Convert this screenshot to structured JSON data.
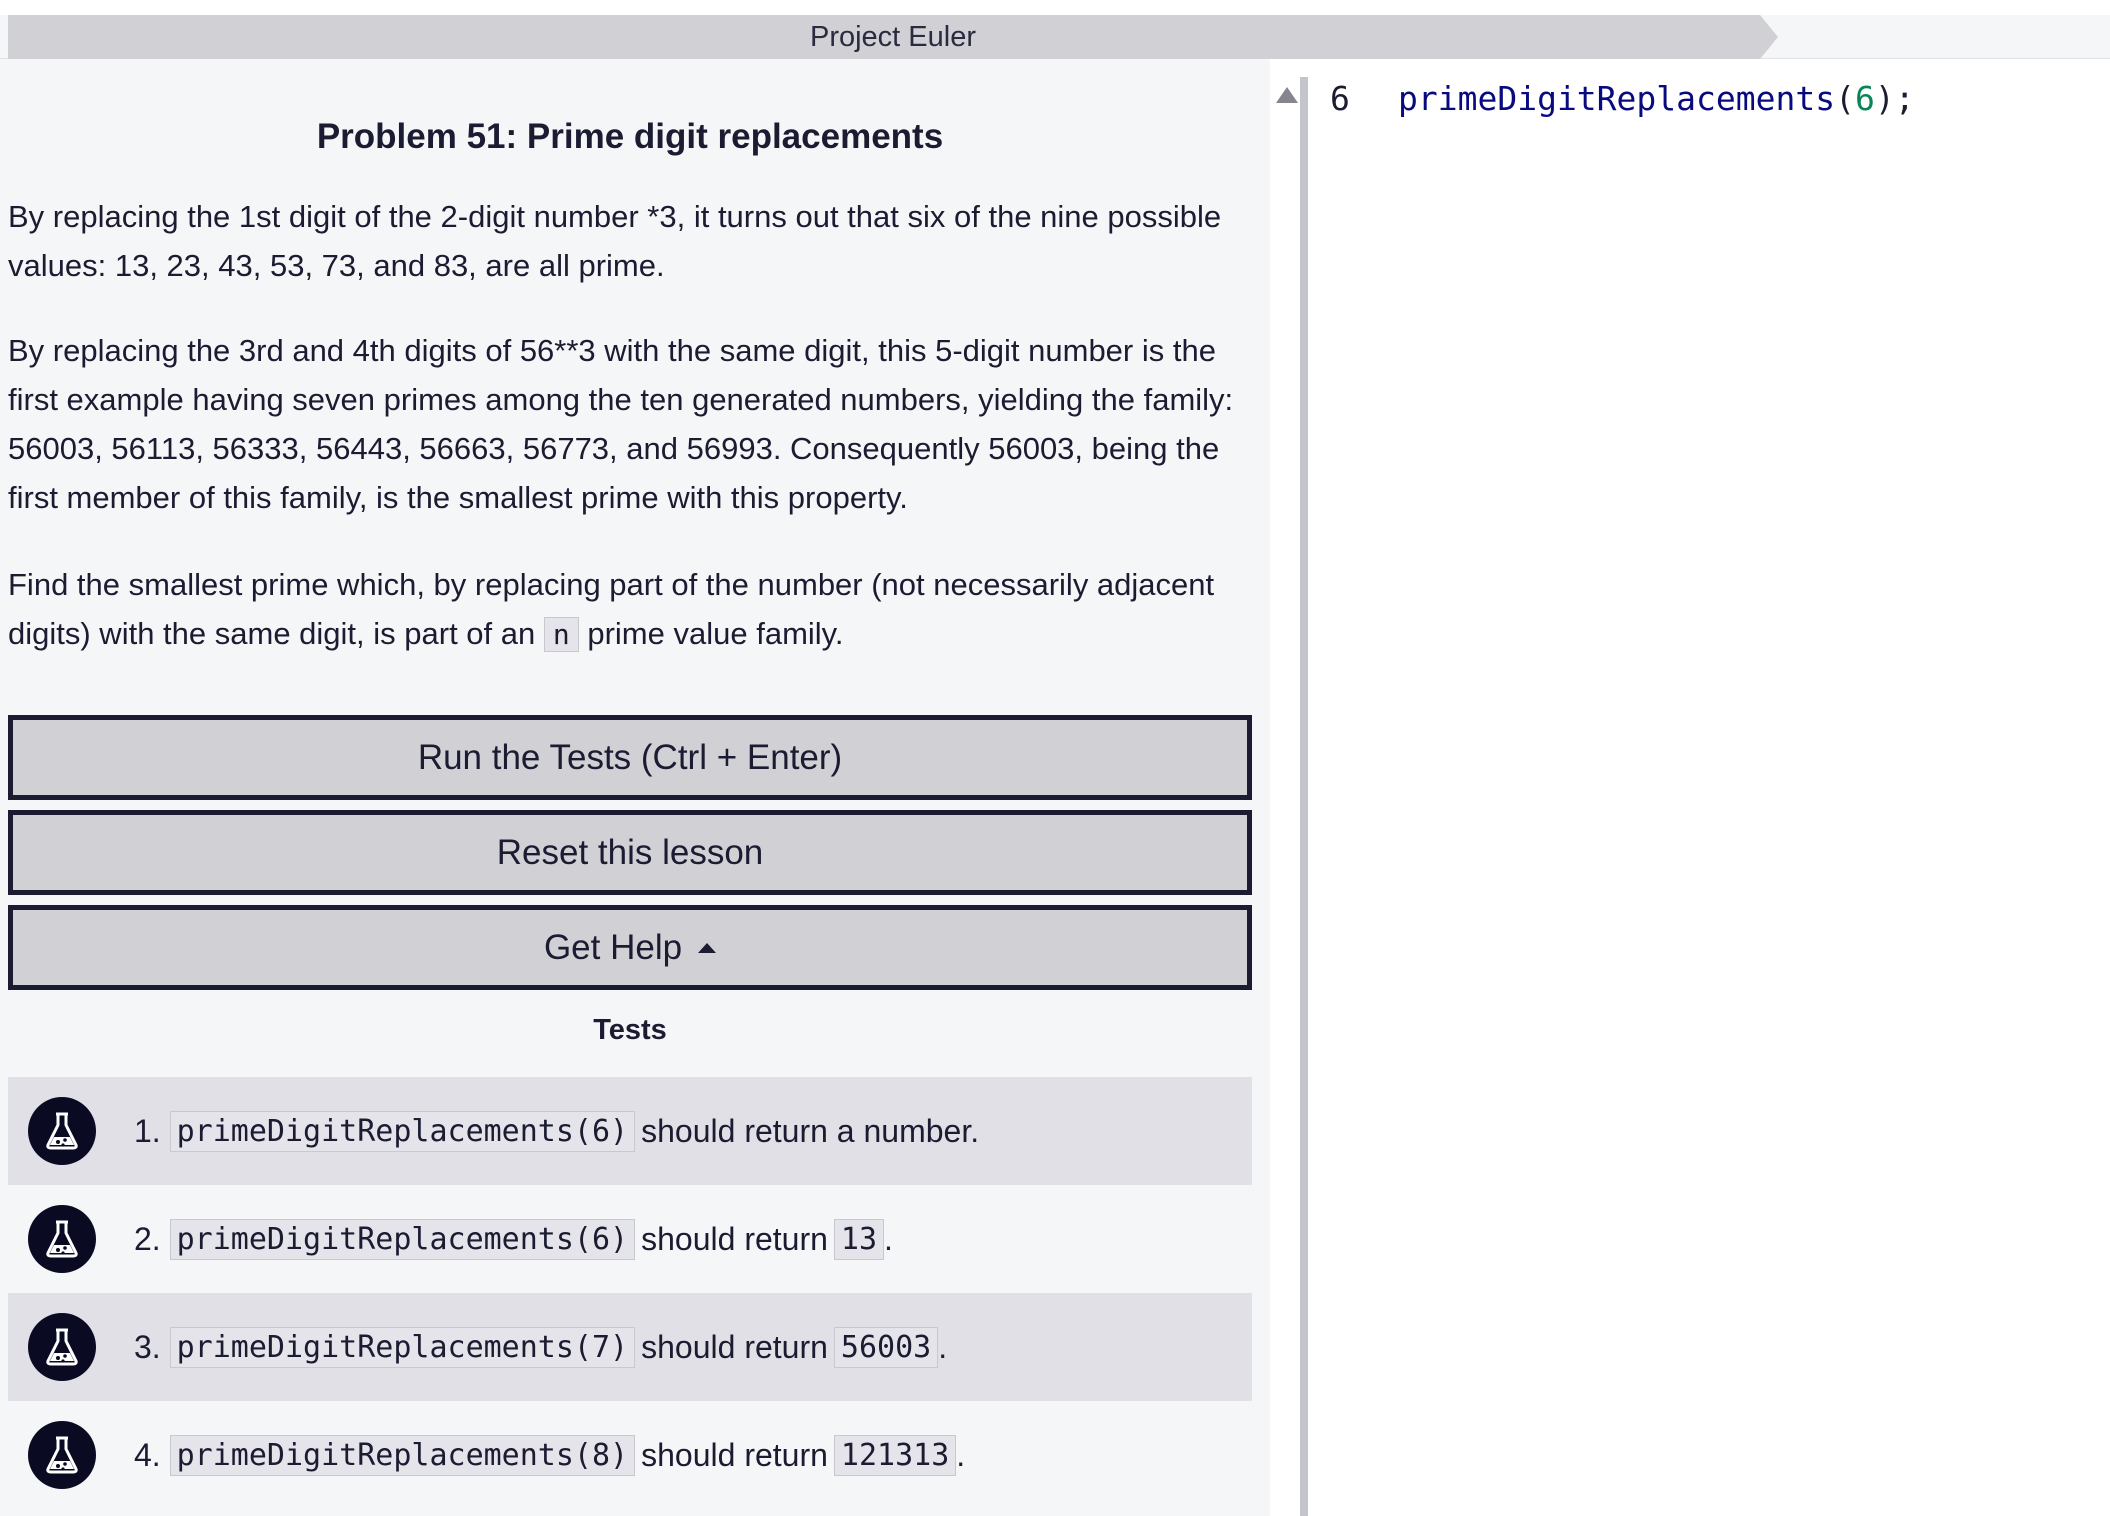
{
  "breadcrumb": {
    "title": "Project Euler"
  },
  "problem": {
    "title": "Problem 51: Prime digit replacements",
    "paragraph1": "By replacing the 1st digit of the 2-digit number *3, it turns out that six of the nine possible values: 13, 23, 43, 53, 73, and 83, are all prime.",
    "paragraph2": "By replacing the 3rd and 4th digits of 56**3 with the same digit, this 5-digit number is the first example having seven primes among the ten generated numbers, yielding the family: 56003, 56113, 56333, 56443, 56663, 56773, and 56993. Consequently 56003, being the first member of this family, is the smallest prime with this property.",
    "paragraph3_before": "Find the smallest prime which, by replacing part of the number (not necessarily adjacent digits) with the same digit, is part of an",
    "paragraph3_code": "n",
    "paragraph3_after": "prime value family."
  },
  "buttons": {
    "run_label": "Run the Tests (Ctrl + Enter)",
    "reset_label": "Reset this lesson",
    "help_label": "Get Help"
  },
  "tests": {
    "heading": "Tests",
    "items": [
      {
        "num": "1.",
        "code": "primeDigitReplacements(6)",
        "text": "should return a number.",
        "value": "",
        "suffix": ""
      },
      {
        "num": "2.",
        "code": "primeDigitReplacements(6)",
        "text": "should return",
        "value": "13",
        "suffix": "."
      },
      {
        "num": "3.",
        "code": "primeDigitReplacements(7)",
        "text": "should return",
        "value": "56003",
        "suffix": "."
      },
      {
        "num": "4.",
        "code": "primeDigitReplacements(8)",
        "text": "should return",
        "value": "121313",
        "suffix": "."
      }
    ]
  },
  "editor": {
    "line_number": "6",
    "code_fn": "primeDigitReplacements",
    "code_open": "(",
    "code_arg": "6",
    "code_close": ");"
  },
  "icons": {
    "test_status": "flask-icon",
    "help_caret": "caret-up-icon",
    "scroll": "scroll-up-arrow-icon"
  },
  "colors": {
    "button_bg": "#d0d0d5",
    "button_border": "#1b1b32",
    "icon_bg": "#0a0a23",
    "pane_bg": "#f5f6f7",
    "row_shade": "#e0e0e6"
  }
}
